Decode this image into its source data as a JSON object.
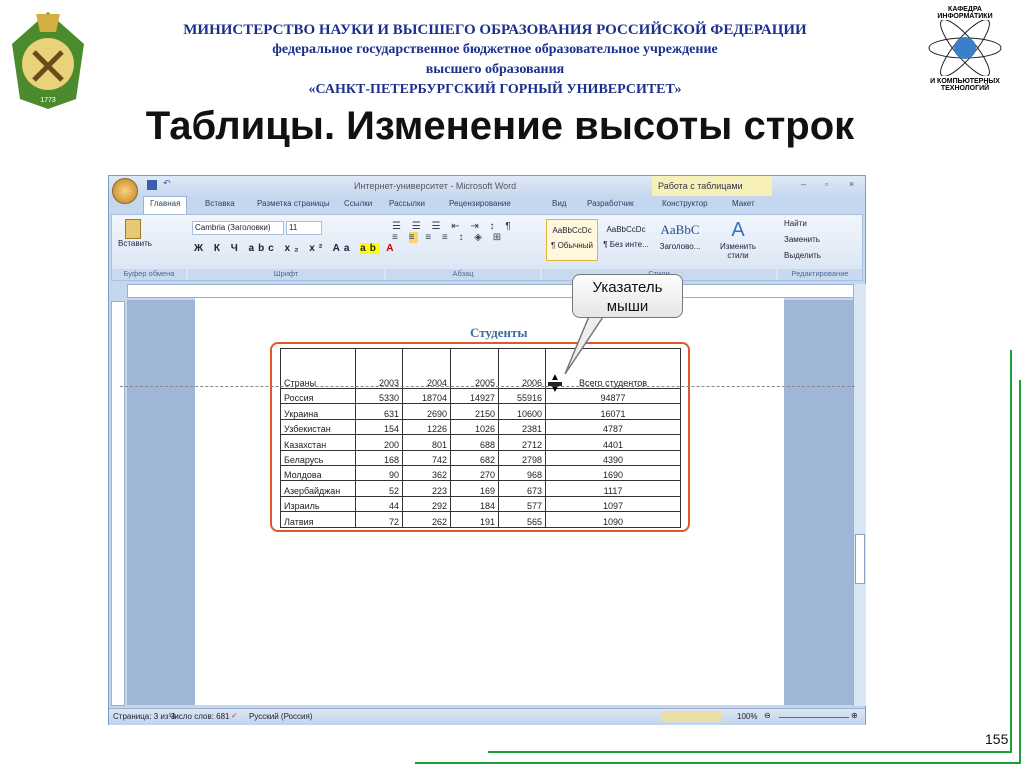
{
  "header": {
    "line1": "МИНИСТЕРСТВО НАУКИ И ВЫСШЕГО ОБРАЗОВАНИЯ РОССИЙСКОЙ ФЕДЕРАЦИИ",
    "line2": "федеральное государственное бюджетное образовательное учреждение",
    "line3": "высшего образования",
    "line4": "«САНКТ-ПЕТЕРБУРГСКИЙ ГОРНЫЙ УНИВЕРСИТЕТ»"
  },
  "logo_right": {
    "top": "КАФЕДРА ИНФОРМАТИКИ",
    "bottom": "И КОМПЬЮТЕРНЫХ ТЕХНОЛОГИЙ"
  },
  "title": "Таблицы. Изменение высоты строк",
  "word": {
    "window_title": "Интернет-университет - Microsoft Word",
    "context_tab": "Работа с таблицами",
    "tabs": [
      "Главная",
      "Вставка",
      "Разметка страницы",
      "Ссылки",
      "Рассылки",
      "Рецензирование",
      "Вид",
      "Разработчик",
      "Конструктор",
      "Макет"
    ],
    "ribbon": {
      "paste": "Вставить",
      "font": "Cambria (Заголовки)",
      "size": "11",
      "styles": [
        {
          "sample": "AaBbCcDc",
          "name": "¶ Обычный"
        },
        {
          "sample": "AaBbCcDc",
          "name": "¶ Без инте..."
        },
        {
          "sample": "AaBbC",
          "name": "Заголово..."
        }
      ],
      "change_styles": "Изменить стили",
      "find": "Найти",
      "replace": "Заменить",
      "select": "Выделить",
      "groups": [
        "Буфер обмена",
        "Шрифт",
        "Абзац",
        "Стили",
        "Редактирование"
      ]
    },
    "status": {
      "page": "Страница: 3 из 3",
      "words": "Число слов: 681",
      "language": "Русский (Россия)",
      "zoom": "100%"
    },
    "doc_title": "Студенты",
    "table": {
      "headers": [
        "Страны",
        "2003",
        "2004",
        "2005",
        "2006",
        "Всего студентов"
      ],
      "rows": [
        [
          "Россия",
          "5330",
          "18704",
          "14927",
          "55916",
          "94877"
        ],
        [
          "Украина",
          "631",
          "2690",
          "2150",
          "10600",
          "16071"
        ],
        [
          "Узбекистан",
          "154",
          "1226",
          "1026",
          "2381",
          "4787"
        ],
        [
          "Казахстан",
          "200",
          "801",
          "688",
          "2712",
          "4401"
        ],
        [
          "Беларусь",
          "168",
          "742",
          "682",
          "2798",
          "4390"
        ],
        [
          "Молдова",
          "90",
          "362",
          "270",
          "968",
          "1690"
        ],
        [
          "Азербайджан",
          "52",
          "223",
          "169",
          "673",
          "1117"
        ],
        [
          "Израиль",
          "44",
          "292",
          "184",
          "577",
          "1097"
        ],
        [
          "Латвия",
          "72",
          "262",
          "191",
          "565",
          "1090"
        ]
      ]
    }
  },
  "callout": {
    "line1": "Указатель",
    "line2": "мыши"
  },
  "page_number": "155"
}
